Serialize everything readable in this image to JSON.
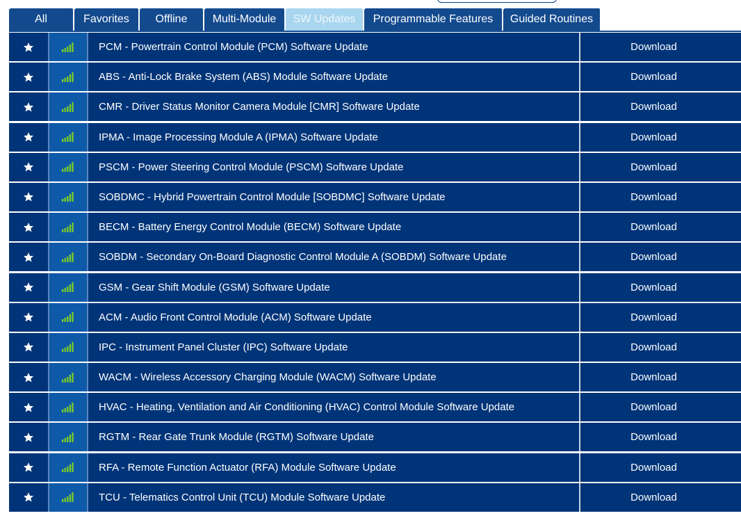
{
  "tabs": [
    {
      "label": "All",
      "active": false
    },
    {
      "label": "Favorites",
      "active": false
    },
    {
      "label": "Offline",
      "active": false
    },
    {
      "label": "Multi-Module",
      "active": false
    },
    {
      "label": "SW Updates",
      "active": true
    },
    {
      "label": "Programmable Features",
      "active": false
    },
    {
      "label": "Guided Routines",
      "active": false
    }
  ],
  "colors": {
    "row_background": "#003478",
    "signal_cell": "#0f5aa8",
    "active_tab": "#a9d6ef",
    "signal_bars": "#7ed321"
  },
  "icons": {
    "favorite": "star-icon",
    "connectivity": "signal-bars-icon"
  },
  "rows": [
    {
      "name": "PCM - Powertrain Control Module (PCM) Software Update",
      "action": "Download"
    },
    {
      "name": "ABS - Anti-Lock Brake System (ABS) Module Software Update",
      "action": "Download"
    },
    {
      "name": "CMR - Driver Status Monitor Camera Module [CMR] Software Update",
      "action": "Download"
    },
    {
      "name": "IPMA - Image Processing Module A (IPMA) Software Update",
      "action": "Download"
    },
    {
      "name": "PSCM - Power Steering Control Module (PSCM) Software Update",
      "action": "Download"
    },
    {
      "name": "SOBDMC - Hybrid Powertrain Control Module [SOBDMC] Software Update",
      "action": "Download"
    },
    {
      "name": "BECM - Battery Energy Control Module (BECM) Software Update",
      "action": "Download"
    },
    {
      "name": "SOBDM - Secondary On-Board Diagnostic Control Module A (SOBDM) Software Update",
      "action": "Download"
    },
    {
      "name": "GSM - Gear Shift Module (GSM) Software Update",
      "action": "Download"
    },
    {
      "name": "ACM - Audio Front Control Module (ACM) Software Update",
      "action": "Download"
    },
    {
      "name": "IPC - Instrument Panel Cluster (IPC) Software Update",
      "action": "Download"
    },
    {
      "name": "WACM - Wireless Accessory Charging Module (WACM) Software Update",
      "action": "Download"
    },
    {
      "name": "HVAC - Heating, Ventilation and Air Conditioning (HVAC) Control Module Software Update",
      "action": "Download"
    },
    {
      "name": "RGTM - Rear Gate Trunk Module (RGTM) Software Update",
      "action": "Download"
    },
    {
      "name": "RFA - Remote Function Actuator (RFA) Module Software Update",
      "action": "Download"
    },
    {
      "name": "TCU - Telematics Control Unit (TCU) Module Software Update",
      "action": "Download"
    }
  ]
}
